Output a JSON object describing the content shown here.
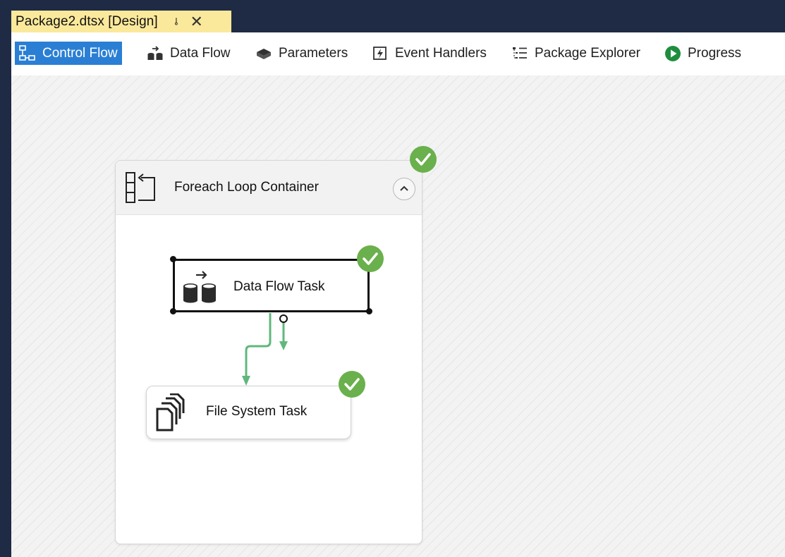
{
  "document_tab": {
    "title": "Package2.dtsx [Design]",
    "pin_glyph": "⊸",
    "close_glyph": "✕"
  },
  "designer_tabs": [
    {
      "label": "Control Flow",
      "icon": "control-flow-icon",
      "active": true
    },
    {
      "label": "Data Flow",
      "icon": "data-flow-icon",
      "active": false
    },
    {
      "label": "Parameters",
      "icon": "parameters-icon",
      "active": false
    },
    {
      "label": "Event Handlers",
      "icon": "event-handlers-icon",
      "active": false
    },
    {
      "label": "Package Explorer",
      "icon": "package-explorer-icon",
      "active": false
    },
    {
      "label": "Progress",
      "icon": "progress-icon",
      "active": false
    }
  ],
  "container": {
    "title": "Foreach Loop Container",
    "icon": "foreach-loop-icon",
    "status": "success"
  },
  "tasks": [
    {
      "title": "Data Flow Task",
      "icon": "data-flow-task-icon",
      "status": "success",
      "selected": true
    },
    {
      "title": "File System Task",
      "icon": "file-system-task-icon",
      "status": "success",
      "selected": false
    }
  ],
  "colors": {
    "tab_active": "#2a7fd4",
    "doc_tab": "#fbe99b",
    "frame": "#1f2a44",
    "success": "#6ab04c",
    "connector": "#5fb87b"
  }
}
